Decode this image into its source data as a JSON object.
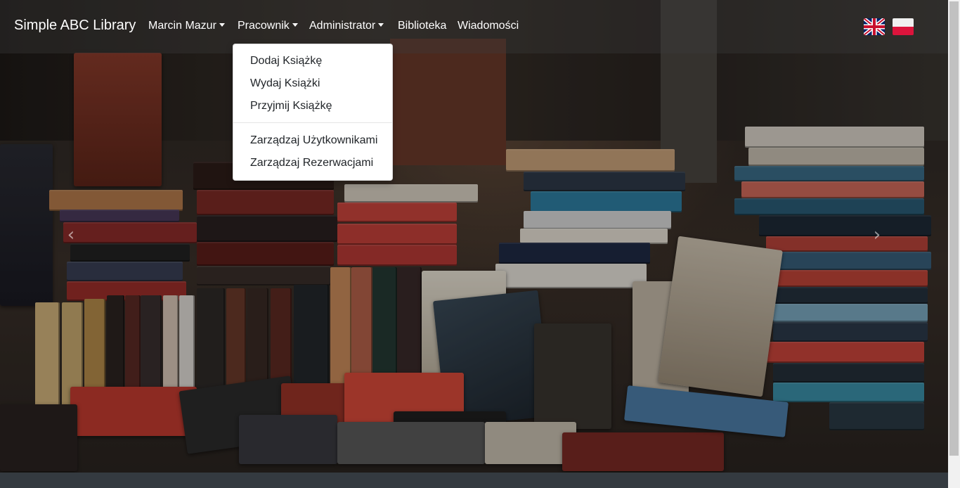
{
  "navbar": {
    "brand": "Simple ABC Library",
    "items": [
      {
        "label": "Marcin Mazur",
        "dropdown": true
      },
      {
        "label": "Pracownik",
        "dropdown": true
      },
      {
        "label": "Administrator",
        "dropdown": true
      },
      {
        "label": "Biblioteka",
        "dropdown": false
      },
      {
        "label": "Wiadomości",
        "dropdown": false
      }
    ],
    "languages": [
      "english-flag",
      "polish-flag"
    ]
  },
  "dropdown": {
    "group1": [
      "Dodaj Książkę",
      "Wydaj Książki",
      "Przyjmij Książkę"
    ],
    "group2": [
      "Zarządzaj Użytkownikami",
      "Zarządzaj Rezerwacjami"
    ]
  },
  "carousel": {
    "prev_icon": "chevron-left-icon",
    "next_icon": "chevron-right-icon",
    "prev_glyph": "‹",
    "next_glyph": "›"
  },
  "colors": {
    "navbar_text": "#ffffff",
    "dropdown_bg": "#ffffff",
    "dropdown_text": "#212529",
    "footer": "#343a40"
  }
}
